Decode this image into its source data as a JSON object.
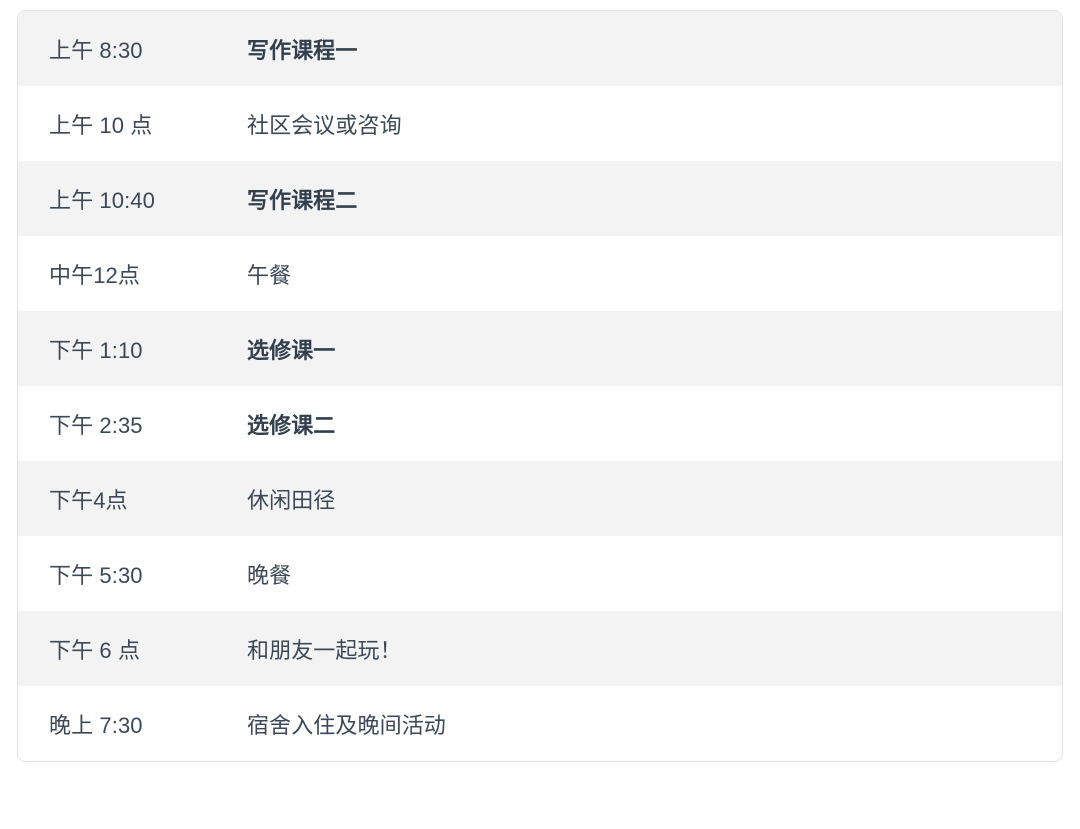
{
  "schedule": {
    "columns": [
      "time",
      "event"
    ],
    "rows": [
      {
        "time": "上午 8:30",
        "event": "写作课程一",
        "bold": true,
        "striped": true
      },
      {
        "time": "上午 10 点",
        "event": "社区会议或咨询",
        "bold": false,
        "striped": false
      },
      {
        "time": "上午 10:40",
        "event": "写作课程二",
        "bold": true,
        "striped": true
      },
      {
        "time": "中午12点",
        "event": "午餐",
        "bold": false,
        "striped": false
      },
      {
        "time": "下午 1:10",
        "event": "选修课一",
        "bold": true,
        "striped": true
      },
      {
        "time": "下午 2:35",
        "event": "选修课二",
        "bold": true,
        "striped": false
      },
      {
        "time": "下午4点",
        "event": "休闲田径",
        "bold": false,
        "striped": true
      },
      {
        "time": "下午 5:30",
        "event": "晚餐",
        "bold": false,
        "striped": false
      },
      {
        "time": "下午 6 点",
        "event": "和朋友一起玩！",
        "bold": false,
        "striped": true
      },
      {
        "time": "晚上 7:30",
        "event": "宿舍入住及晚间活动",
        "bold": false,
        "striped": false
      }
    ]
  },
  "colors": {
    "page_background": "#ffffff",
    "card_background": "#ffffff",
    "card_border": "#e3e3e5",
    "stripe": "#f3f3f4",
    "text": "#3c4858",
    "text_bold": "#32404e"
  }
}
